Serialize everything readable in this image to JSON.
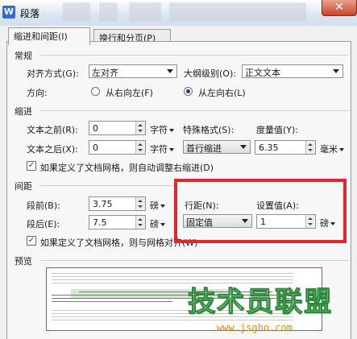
{
  "window": {
    "title": "段落",
    "app_icon": "W",
    "close_label": "✕"
  },
  "tabs": [
    {
      "label": "缩进和间距(I)"
    },
    {
      "label": "换行和分页(P)"
    }
  ],
  "general": {
    "title": "常规",
    "alignment_label": "对齐方式(G):",
    "alignment_value": "左对齐",
    "outline_label": "大纲级别(O):",
    "outline_value": "正文文本",
    "direction_label": "方向:",
    "rtl_label": "从右向左(F)",
    "ltr_label": "从左向右(L)"
  },
  "indent": {
    "title": "缩进",
    "before_label": "文本之前(R):",
    "before_value": "0",
    "before_unit": "字符",
    "after_label": "文本之后(X):",
    "after_value": "0",
    "after_unit": "字符",
    "special_label": "特殊格式(S):",
    "special_value": "首行缩进",
    "measure_label": "度量值(Y):",
    "measure_value": "6.35",
    "measure_unit": "毫米",
    "grid_check_label": "如果定义了文档网格，则自动调整右缩进(D)"
  },
  "spacing": {
    "title": "间距",
    "before_label": "段前(B):",
    "before_value": "3.75",
    "before_unit": "磅",
    "after_label": "段后(E):",
    "after_value": "7.5",
    "after_unit": "磅",
    "line_label": "行距(N):",
    "line_value": "固定值",
    "setting_label": "设置值(A):",
    "setting_value": "1",
    "setting_unit": "磅",
    "grid_check_label": "如果定义了文档网格，则与网格对齐(W)"
  },
  "preview": {
    "title": "预览"
  },
  "watermark": {
    "big": "技术员联盟",
    "small": "www.jsgho.com"
  },
  "colors": {
    "highlight_box": "#e0252c",
    "title_bar": "#dce6f1",
    "close": "#c8452c"
  }
}
